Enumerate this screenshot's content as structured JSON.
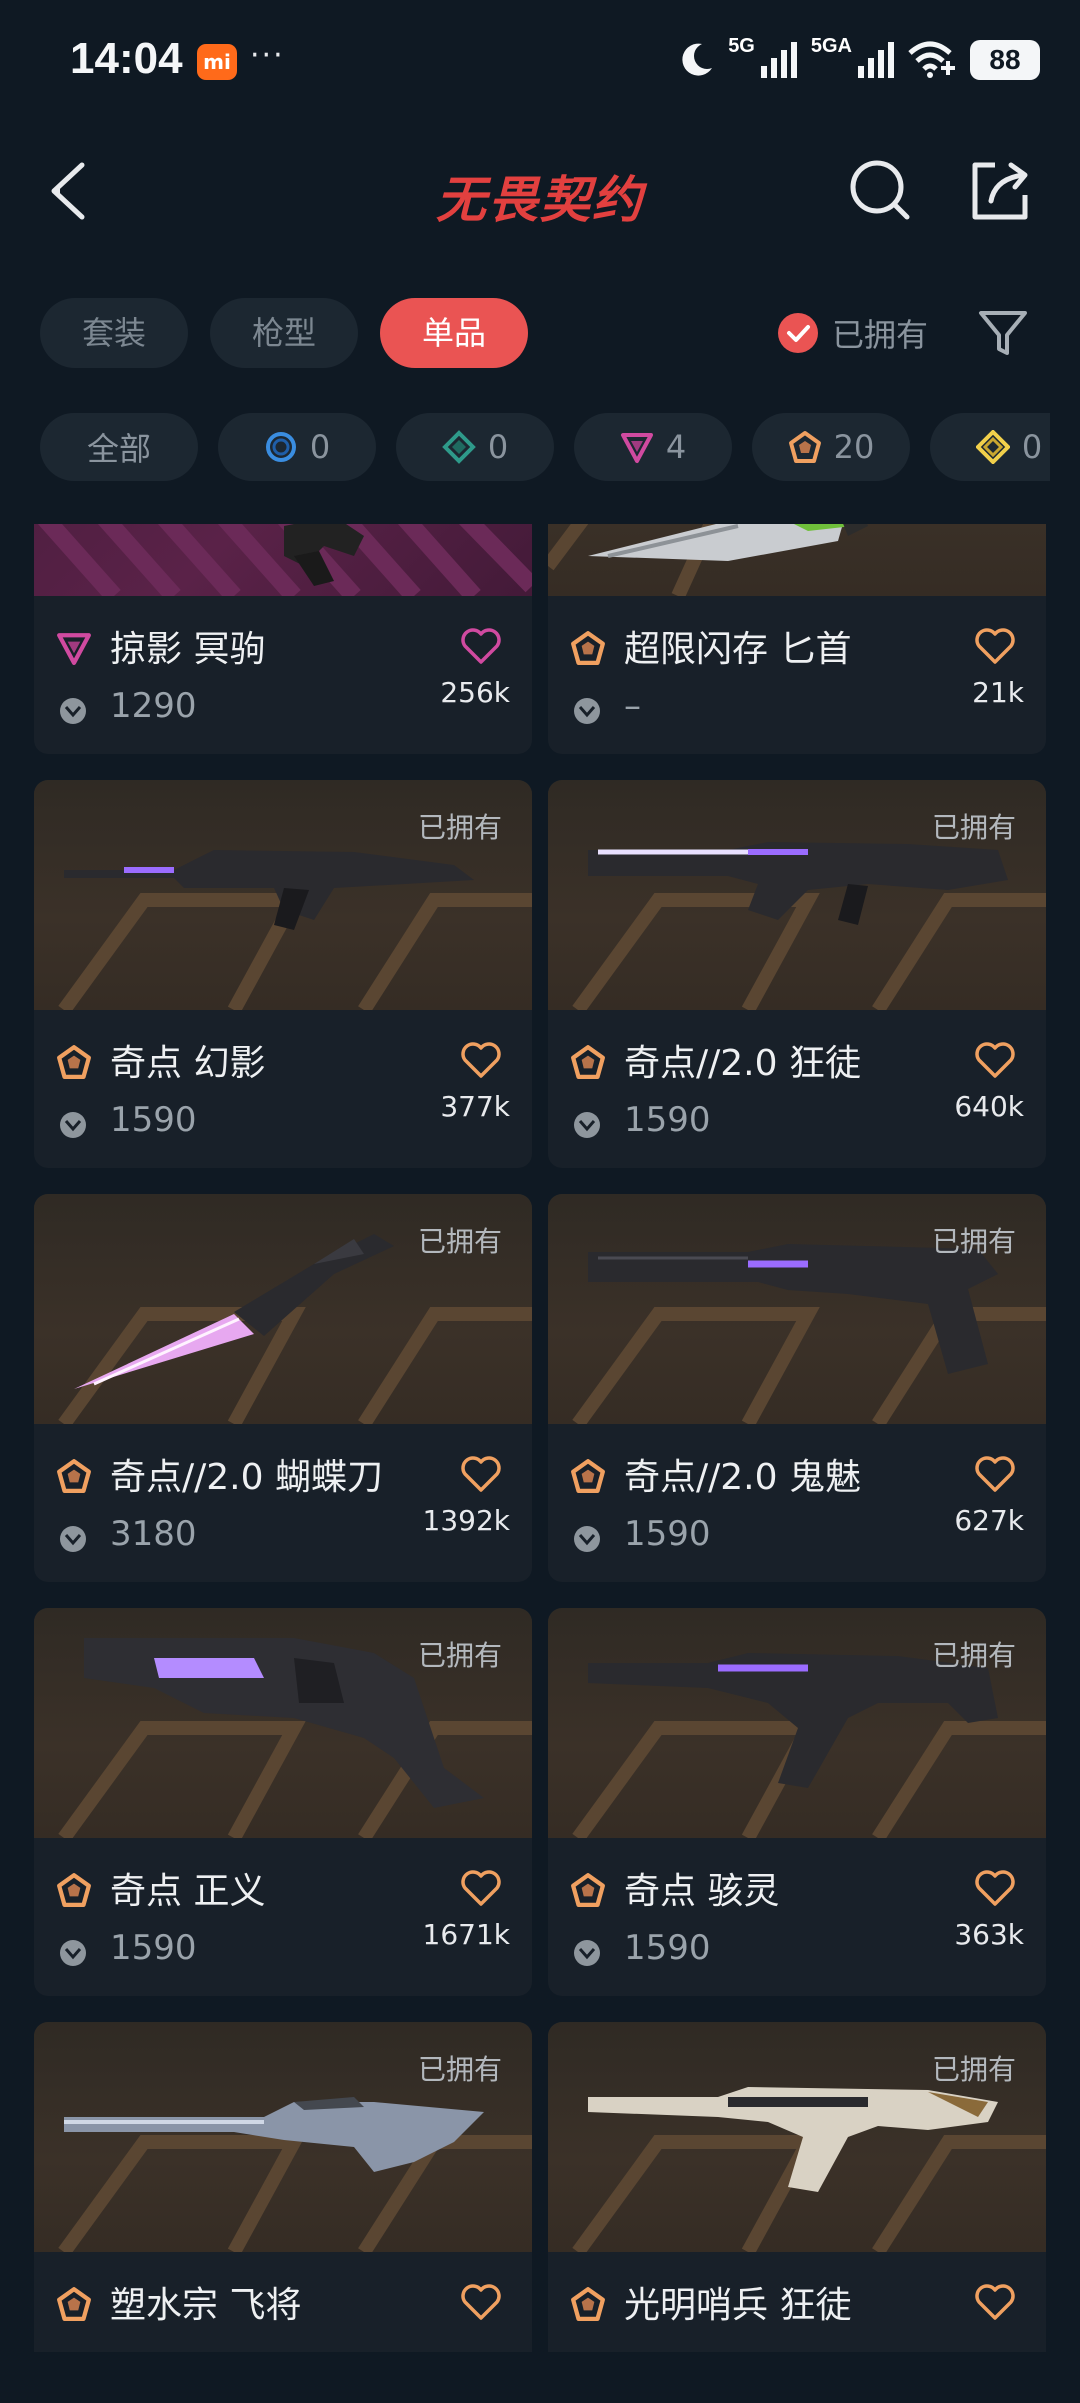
{
  "status_bar": {
    "time": "14:04",
    "mi_badge": "mi",
    "dots": "···",
    "net1": "5G",
    "net2": "5GA",
    "battery": "88"
  },
  "header": {
    "title": "无畏契约"
  },
  "tabs": [
    "套装",
    "枪型",
    "单品"
  ],
  "active_tab": "单品",
  "owned_filter": {
    "label": "已拥有",
    "checked": true
  },
  "rarity_chips": [
    {
      "label": "全部",
      "icon": "none"
    },
    {
      "label": "0",
      "icon": "select-tier-icon",
      "color": "#3a8de0"
    },
    {
      "label": "0",
      "icon": "deluxe-tier-icon",
      "color": "#2e9a8a"
    },
    {
      "label": "4",
      "icon": "premium-tier-icon",
      "color": "#d04aa0"
    },
    {
      "label": "20",
      "icon": "exclusive-tier-icon",
      "color": "#f0a060"
    },
    {
      "label": "0",
      "icon": "ultra-tier-icon",
      "color": "#f1d04b"
    }
  ],
  "cards": [
    {
      "name": "掠影 冥驹",
      "tier": "premium",
      "price": "1290",
      "likes": "256k",
      "owned": "",
      "heart_color": "#d04aa0"
    },
    {
      "name": "超限闪存 匕首",
      "tier": "exclusive",
      "price": "–",
      "likes": "21k",
      "owned": "",
      "heart_color": "#f0a060"
    },
    {
      "name": "奇点 幻影",
      "tier": "exclusive",
      "price": "1590",
      "likes": "377k",
      "owned": "已拥有",
      "heart_color": "#f0a060"
    },
    {
      "name": "奇点//2.0 狂徒",
      "tier": "exclusive",
      "price": "1590",
      "likes": "640k",
      "owned": "已拥有",
      "heart_color": "#f0a060"
    },
    {
      "name": "奇点//2.0 蝴蝶刀",
      "tier": "exclusive",
      "price": "3180",
      "likes": "1392k",
      "owned": "已拥有",
      "heart_color": "#f0a060"
    },
    {
      "name": "奇点//2.0 鬼魅",
      "tier": "exclusive",
      "price": "1590",
      "likes": "627k",
      "owned": "已拥有",
      "heart_color": "#f0a060"
    },
    {
      "name": "奇点 正义",
      "tier": "exclusive",
      "price": "1590",
      "likes": "1671k",
      "owned": "已拥有",
      "heart_color": "#f0a060"
    },
    {
      "name": "奇点 骇灵",
      "tier": "exclusive",
      "price": "1590",
      "likes": "363k",
      "owned": "已拥有",
      "heart_color": "#f0a060"
    },
    {
      "name": "塑水宗 飞将",
      "tier": "exclusive",
      "price": "",
      "likes": "",
      "owned": "已拥有",
      "heart_color": "#f0a060"
    },
    {
      "name": "光明哨兵 狂徒",
      "tier": "exclusive",
      "price": "",
      "likes": "",
      "owned": "已拥有",
      "heart_color": "#f0a060"
    }
  ]
}
